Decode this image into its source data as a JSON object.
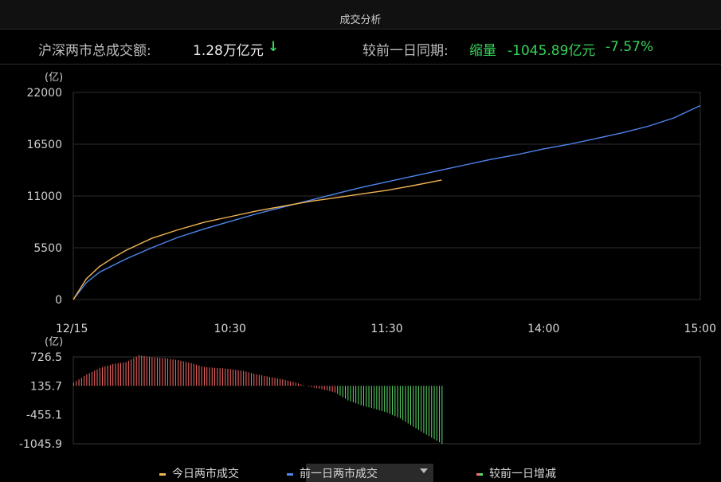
{
  "header": {
    "title": "成交分析"
  },
  "summary": {
    "total_label": "沪深两市总成交额:",
    "total_value": "1.28万亿元",
    "compare_label": "较前一日同期:",
    "compare_status": "缩量",
    "compare_change": "-1045.89亿元",
    "compare_pct": "-7.57%"
  },
  "colors": {
    "today": "#f0b452",
    "prev": "#4f86ee",
    "up": "#ff6a6a",
    "down": "#5ddc6a",
    "up_arrow": "#36d35a"
  },
  "icons": {
    "trend": "down-arrow-icon",
    "dropdown": "chevron-down-icon"
  },
  "legend": {
    "today": "今日两市成交",
    "prev": "前一日两市成交",
    "diff": "较前一日增减"
  },
  "chart_data": [
    {
      "type": "line",
      "unit_label": "(亿)",
      "x_ticks": [
        "12/15",
        "10:30",
        "11:30",
        "14:00",
        "15:00"
      ],
      "x_minutes_of_ticks": [
        0,
        60,
        120,
        180,
        240
      ],
      "ylim": [
        0,
        22000
      ],
      "y_ticks": [
        0,
        5500,
        11000,
        16500,
        22000
      ],
      "y_tick_labels": [
        "0",
        "5500",
        "11000",
        "16500",
        "22000"
      ],
      "grid": true,
      "series": [
        {
          "name": "今日两市成交",
          "x": [
            0,
            5,
            10,
            15,
            20,
            30,
            40,
            50,
            60,
            70,
            80,
            90,
            100,
            110,
            120,
            130,
            141
          ],
          "values": [
            0,
            2200,
            3500,
            4400,
            5200,
            6500,
            7400,
            8200,
            8800,
            9400,
            9900,
            10400,
            10800,
            11200,
            11600,
            12100,
            12700
          ]
        },
        {
          "name": "前一日两市成交",
          "x": [
            0,
            5,
            10,
            20,
            30,
            40,
            50,
            60,
            70,
            80,
            90,
            100,
            110,
            120,
            130,
            140,
            150,
            160,
            170,
            180,
            190,
            200,
            210,
            220,
            230,
            240
          ],
          "values": [
            0,
            1800,
            2900,
            4300,
            5500,
            6600,
            7500,
            8300,
            9100,
            9800,
            10500,
            11200,
            11900,
            12500,
            13100,
            13700,
            14300,
            14900,
            15400,
            16000,
            16500,
            17100,
            17700,
            18400,
            19300,
            20600
          ]
        }
      ]
    },
    {
      "type": "bar",
      "unit_label": "(亿)",
      "ylim": [
        -1045.9,
        726.5
      ],
      "y_ticks": [
        726.5,
        135.7,
        -455.1,
        -1045.9
      ],
      "y_tick_labels": [
        "726.5",
        "135.7",
        "-455.1",
        "-1045.9"
      ],
      "series": [
        {
          "name": "较前一日增减",
          "x": [
            0,
            5,
            10,
            15,
            20,
            25,
            30,
            35,
            40,
            45,
            50,
            55,
            60,
            65,
            70,
            75,
            80,
            85,
            90,
            95,
            100,
            105,
            110,
            115,
            120,
            125,
            130,
            135,
            141
          ],
          "values": [
            200,
            370,
            500,
            580,
            620,
            760,
            720,
            700,
            660,
            600,
            520,
            500,
            480,
            440,
            370,
            320,
            270,
            200,
            120,
            70,
            0,
            -160,
            -260,
            -330,
            -410,
            -530,
            -700,
            -860,
            -1045.9
          ]
        }
      ]
    }
  ]
}
